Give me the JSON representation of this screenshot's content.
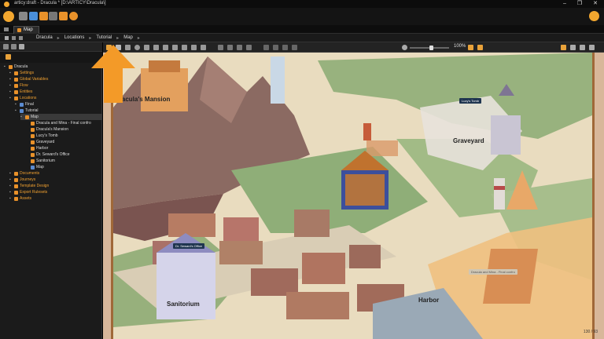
{
  "app": {
    "title": "articy:draft - Dracula * [D:\\ARTICY\\Dracula\\]",
    "window_controls": [
      "–",
      "❐",
      "✕"
    ]
  },
  "tab": {
    "label": "Map"
  },
  "breadcrumb": [
    "Dracula",
    "Locations",
    "Tutorial",
    "Map"
  ],
  "map_toolbar": {
    "zoom": "100%",
    "zoom_fraction": 0.55
  },
  "tree": [
    {
      "label": "Dracula",
      "level": 0,
      "orange": false,
      "sel": false,
      "icon": "#e8912a"
    },
    {
      "label": "Settings",
      "level": 1,
      "orange": true,
      "sel": false,
      "icon": "#e8912a"
    },
    {
      "label": "Global Variables",
      "level": 1,
      "orange": true,
      "sel": false,
      "icon": "#e8912a"
    },
    {
      "label": "Flow",
      "level": 1,
      "orange": true,
      "sel": false,
      "icon": "#e8912a"
    },
    {
      "label": "Entities",
      "level": 1,
      "orange": true,
      "sel": false,
      "icon": "#e8912a"
    },
    {
      "label": "Locations",
      "level": 1,
      "orange": true,
      "sel": false,
      "icon": "#e8912a"
    },
    {
      "label": "Final",
      "level": 2,
      "orange": false,
      "sel": false,
      "icon": "#5b8bd0"
    },
    {
      "label": "Tutorial",
      "level": 2,
      "orange": false,
      "sel": false,
      "icon": "#5b8bd0"
    },
    {
      "label": "Map",
      "level": 3,
      "orange": false,
      "sel": true,
      "icon": "#e8912a"
    },
    {
      "label": "Dracula and Mina - Final confro",
      "level": 4,
      "orange": false,
      "sel": false,
      "icon": "#e8912a"
    },
    {
      "label": "Dracula's Mansion",
      "level": 4,
      "orange": false,
      "sel": false,
      "icon": "#e8912a"
    },
    {
      "label": "Lucy's Tomb",
      "level": 4,
      "orange": false,
      "sel": false,
      "icon": "#e8912a"
    },
    {
      "label": "Graveyard",
      "level": 4,
      "orange": false,
      "sel": false,
      "icon": "#e8912a"
    },
    {
      "label": "Harbor",
      "level": 4,
      "orange": false,
      "sel": false,
      "icon": "#e8912a"
    },
    {
      "label": "Dr. Seward's Office",
      "level": 4,
      "orange": false,
      "sel": false,
      "icon": "#e8912a"
    },
    {
      "label": "Sanitorium",
      "level": 4,
      "orange": false,
      "sel": false,
      "icon": "#e8912a"
    },
    {
      "label": "Map",
      "level": 4,
      "orange": false,
      "sel": false,
      "icon": "#5b8bd0"
    },
    {
      "label": "Documents",
      "level": 1,
      "orange": true,
      "sel": false,
      "icon": "#e8912a"
    },
    {
      "label": "Journeys",
      "level": 1,
      "orange": true,
      "sel": false,
      "icon": "#e8912a"
    },
    {
      "label": "Template Design",
      "level": 1,
      "orange": true,
      "sel": false,
      "icon": "#e8912a"
    },
    {
      "label": "Export Rulesets",
      "level": 1,
      "orange": true,
      "sel": false,
      "icon": "#e8912a"
    },
    {
      "label": "Assets",
      "level": 1,
      "orange": true,
      "sel": false,
      "icon": "#e8912a"
    }
  ],
  "map": {
    "labels": {
      "mansion": "Dracula's Mansion",
      "graveyard": "Graveyard",
      "sanitorium": "Sanitorium",
      "harbor": "Harbor"
    },
    "pins": {
      "lucys_tomb": "Lucy's Tomb",
      "seward": "Dr. Seward's Office",
      "final": "Dracula and Mina - Final confro"
    },
    "scroll": "130 / 93"
  }
}
